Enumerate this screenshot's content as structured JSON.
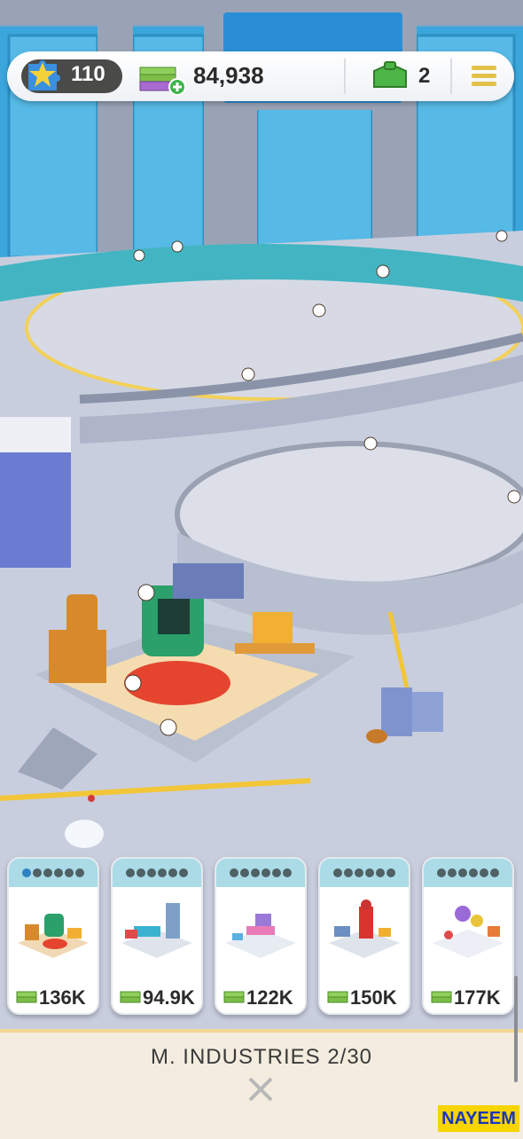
{
  "hud": {
    "xp_level": "110",
    "cash": "84,938",
    "boxes": "2",
    "icons": {
      "xp": "puzzle-star-icon",
      "cash": "cash-stack-plus-icon",
      "box": "green-box-icon",
      "menu": "hamburger-menu-icon"
    }
  },
  "cards": [
    {
      "price": "136K",
      "filled_dots": 1,
      "total_dots": 6,
      "thumb": "robot-station"
    },
    {
      "price": "94.9K",
      "filled_dots": 0,
      "total_dots": 6,
      "thumb": "lab-console"
    },
    {
      "price": "122K",
      "filled_dots": 0,
      "total_dots": 6,
      "thumb": "pink-workbench"
    },
    {
      "price": "150K",
      "filled_dots": 0,
      "total_dots": 6,
      "thumb": "red-phone-booth"
    },
    {
      "price": "177K",
      "filled_dots": 0,
      "total_dots": 6,
      "thumb": "purple-orbs"
    }
  ],
  "panel": {
    "title": "M. INDUSTRIES 2/30"
  },
  "watermark": "NAYEEM",
  "colors": {
    "dot_on": "#2f7fc3",
    "dot_off": "#4f6165",
    "card_header": "#aadbe7",
    "panel_bg": "#f3ecdf"
  }
}
